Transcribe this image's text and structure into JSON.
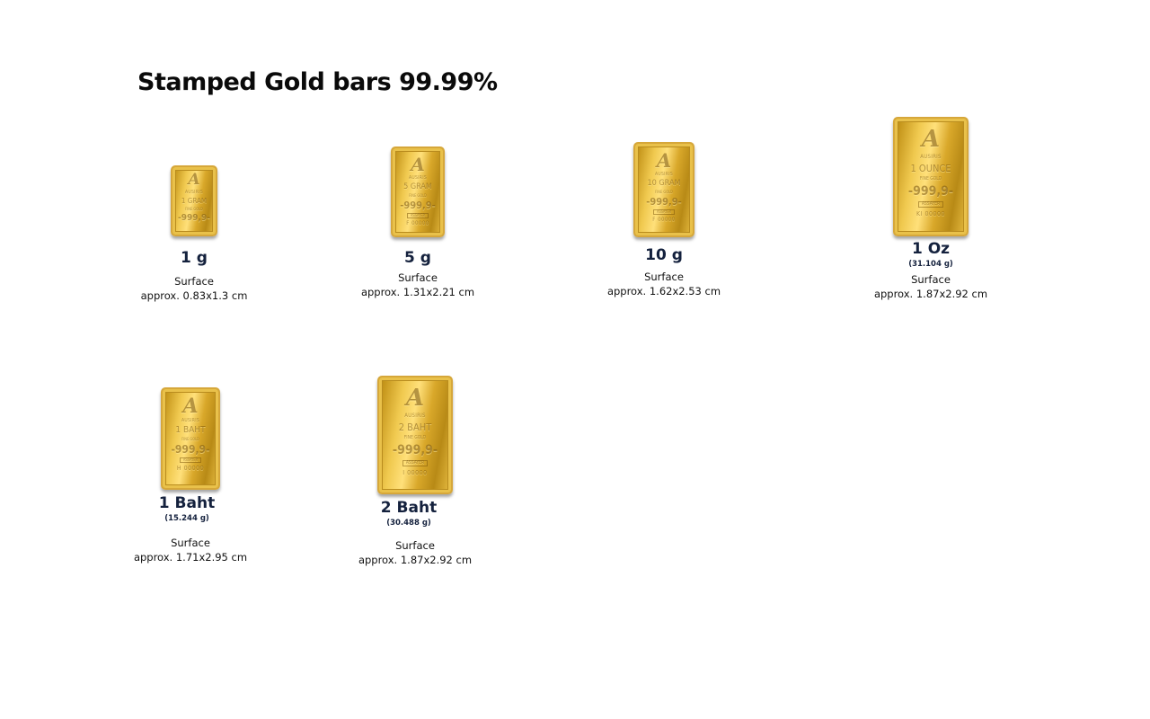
{
  "page": {
    "title": "Stamped Gold bars 99.99%"
  },
  "products": [
    {
      "name": "1 g",
      "sub": "",
      "surface_label": "Surface",
      "surface_value": "approx. 0.83x1.3 cm",
      "bar": {
        "logo": "A",
        "brand": "AUSIRIS",
        "weight": "1 GRAM",
        "fine": "FINE GOLD",
        "purity": "-999,9-",
        "stamp": "",
        "serial": ""
      }
    },
    {
      "name": "5 g",
      "sub": "",
      "surface_label": "Surface",
      "surface_value": "approx. 1.31x2.21 cm",
      "bar": {
        "logo": "A",
        "brand": "AUSIRIS",
        "weight": "5 GRAM",
        "fine": "FINE GOLD",
        "purity": "-999,9-",
        "stamp": "ASSAYER",
        "serial": "F 00000"
      }
    },
    {
      "name": "10 g",
      "sub": "",
      "surface_label": "Surface",
      "surface_value": "approx. 1.62x2.53 cm",
      "bar": {
        "logo": "A",
        "brand": "AUSIRIS",
        "weight": "10 GRAM",
        "fine": "FINE GOLD",
        "purity": "-999,9-",
        "stamp": "ASSAYER",
        "serial": "F 00000"
      }
    },
    {
      "name": "1 Oz",
      "sub": "(31.104 g)",
      "surface_label": "Surface",
      "surface_value": "approx. 1.87x2.92 cm",
      "bar": {
        "logo": "A",
        "brand": "AUSIRIS",
        "weight": "1 OUNCE",
        "fine": "FINE GOLD",
        "purity": "-999,9-",
        "stamp": "ASSAYER",
        "serial": "KI 00000"
      }
    },
    {
      "name": "1 Baht",
      "sub": "(15.244 g)",
      "surface_label": "Surface",
      "surface_value": "approx. 1.71x2.95 cm",
      "bar": {
        "logo": "A",
        "brand": "AUSIRIS",
        "weight": "1 BAHT",
        "fine": "FINE GOLD",
        "purity": "-999,9-",
        "stamp": "ASSAYER",
        "serial": "H 00000"
      }
    },
    {
      "name": "2 Baht",
      "sub": "(30.488 g)",
      "surface_label": "Surface",
      "surface_value": "approx. 1.87x2.92 cm",
      "bar": {
        "logo": "A",
        "brand": "AUSIRIS",
        "weight": "2 BAHT",
        "fine": "FINE GOLD",
        "purity": "-999,9-",
        "stamp": "ASSAYER",
        "serial": "I 00000"
      }
    }
  ],
  "colors": {
    "gold": "#e2b53c",
    "name_text": "#14213d",
    "title_text": "#0a0a0a"
  }
}
